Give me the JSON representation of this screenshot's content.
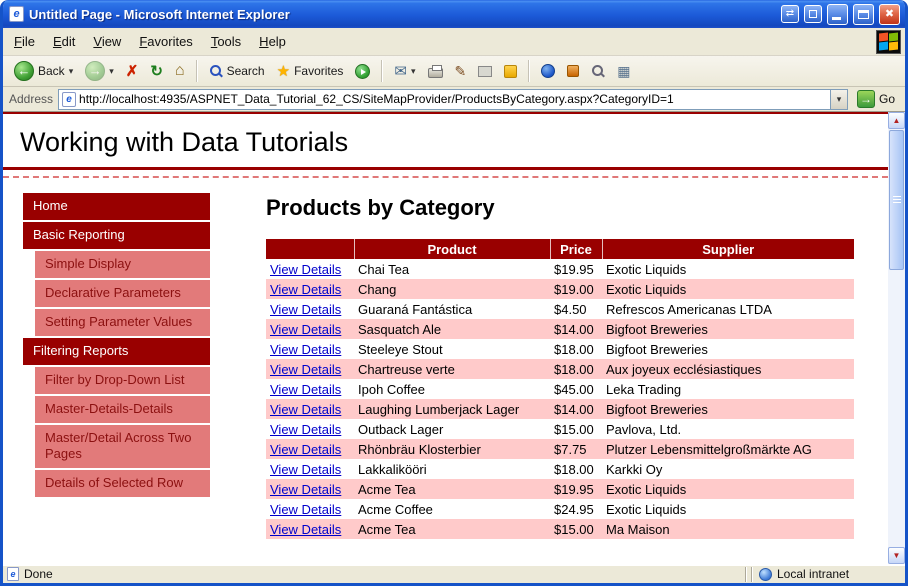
{
  "window": {
    "title": "Untitled Page - Microsoft Internet Explorer"
  },
  "menu_bar": {
    "items": [
      "File",
      "Edit",
      "View",
      "Favorites",
      "Tools",
      "Help"
    ]
  },
  "toolbar": {
    "back": "Back",
    "search": "Search",
    "favorites": "Favorites"
  },
  "address_bar": {
    "label": "Address",
    "url": "http://localhost:4935/ASPNET_Data_Tutorial_62_CS/SiteMapProvider/ProductsByCategory.aspx?CategoryID=1",
    "go": "Go"
  },
  "icons": {
    "back": "←",
    "forward": "→",
    "stop": "✗",
    "refresh": "↻",
    "home": "⌂",
    "favorites_star": "★",
    "mail": "✉",
    "edit": "✎",
    "dev_grid": "▦",
    "dropdown": "▾",
    "scroll_up": "▲",
    "scroll_down": "▼",
    "go_arrow": "→",
    "close": "✖",
    "swap": "⇄",
    "page_e": "e"
  },
  "page": {
    "site_title": "Working with Data Tutorials",
    "heading": "Products by Category",
    "sidebar": [
      {
        "label": "Home",
        "level": 1
      },
      {
        "label": "Basic Reporting",
        "level": 1
      },
      {
        "label": "Simple Display",
        "level": 2
      },
      {
        "label": "Declarative Parameters",
        "level": 2
      },
      {
        "label": "Setting Parameter Values",
        "level": 2
      },
      {
        "label": "Filtering Reports",
        "level": 1
      },
      {
        "label": "Filter by Drop-Down List",
        "level": 2
      },
      {
        "label": "Master-Details-Details",
        "level": 2
      },
      {
        "label": "Master/Detail Across Two Pages",
        "level": 2
      },
      {
        "label": "Details of Selected Row",
        "level": 2
      }
    ],
    "table": {
      "headers": [
        "",
        "Product",
        "Price",
        "Supplier"
      ],
      "view_details": "View Details",
      "rows": [
        {
          "product": "Chai Tea",
          "price": "$19.95",
          "supplier": "Exotic Liquids"
        },
        {
          "product": "Chang",
          "price": "$19.00",
          "supplier": "Exotic Liquids"
        },
        {
          "product": "Guaraná Fantástica",
          "price": "$4.50",
          "supplier": "Refrescos Americanas LTDA"
        },
        {
          "product": "Sasquatch Ale",
          "price": "$14.00",
          "supplier": "Bigfoot Breweries"
        },
        {
          "product": "Steeleye Stout",
          "price": "$18.00",
          "supplier": "Bigfoot Breweries"
        },
        {
          "product": "Chartreuse verte",
          "price": "$18.00",
          "supplier": "Aux joyeux ecclésiastiques"
        },
        {
          "product": "Ipoh Coffee",
          "price": "$45.00",
          "supplier": "Leka Trading"
        },
        {
          "product": "Laughing Lumberjack Lager",
          "price": "$14.00",
          "supplier": "Bigfoot Breweries"
        },
        {
          "product": "Outback Lager",
          "price": "$15.00",
          "supplier": "Pavlova, Ltd."
        },
        {
          "product": "Rhönbräu Klosterbier",
          "price": "$7.75",
          "supplier": "Plutzer Lebensmittelgroßmärkte AG"
        },
        {
          "product": "Lakkalikööri",
          "price": "$18.00",
          "supplier": "Karkki Oy"
        },
        {
          "product": "Acme Tea",
          "price": "$19.95",
          "supplier": "Exotic Liquids"
        },
        {
          "product": "Acme Coffee",
          "price": "$24.95",
          "supplier": "Exotic Liquids"
        },
        {
          "product": "Acme Tea",
          "price": "$15.00",
          "supplier": "Ma Maison"
        }
      ]
    }
  },
  "status_bar": {
    "status": "Done",
    "zone": "Local intranet"
  },
  "colors": {
    "header_red": "#990000",
    "nav_sub_pink": "#E27A7A",
    "row_alt_pink": "#FFCACA",
    "link_blue": "#0000CC",
    "titlebar_blue": "#1C5AD8",
    "go_green": "#3C9A3C"
  }
}
